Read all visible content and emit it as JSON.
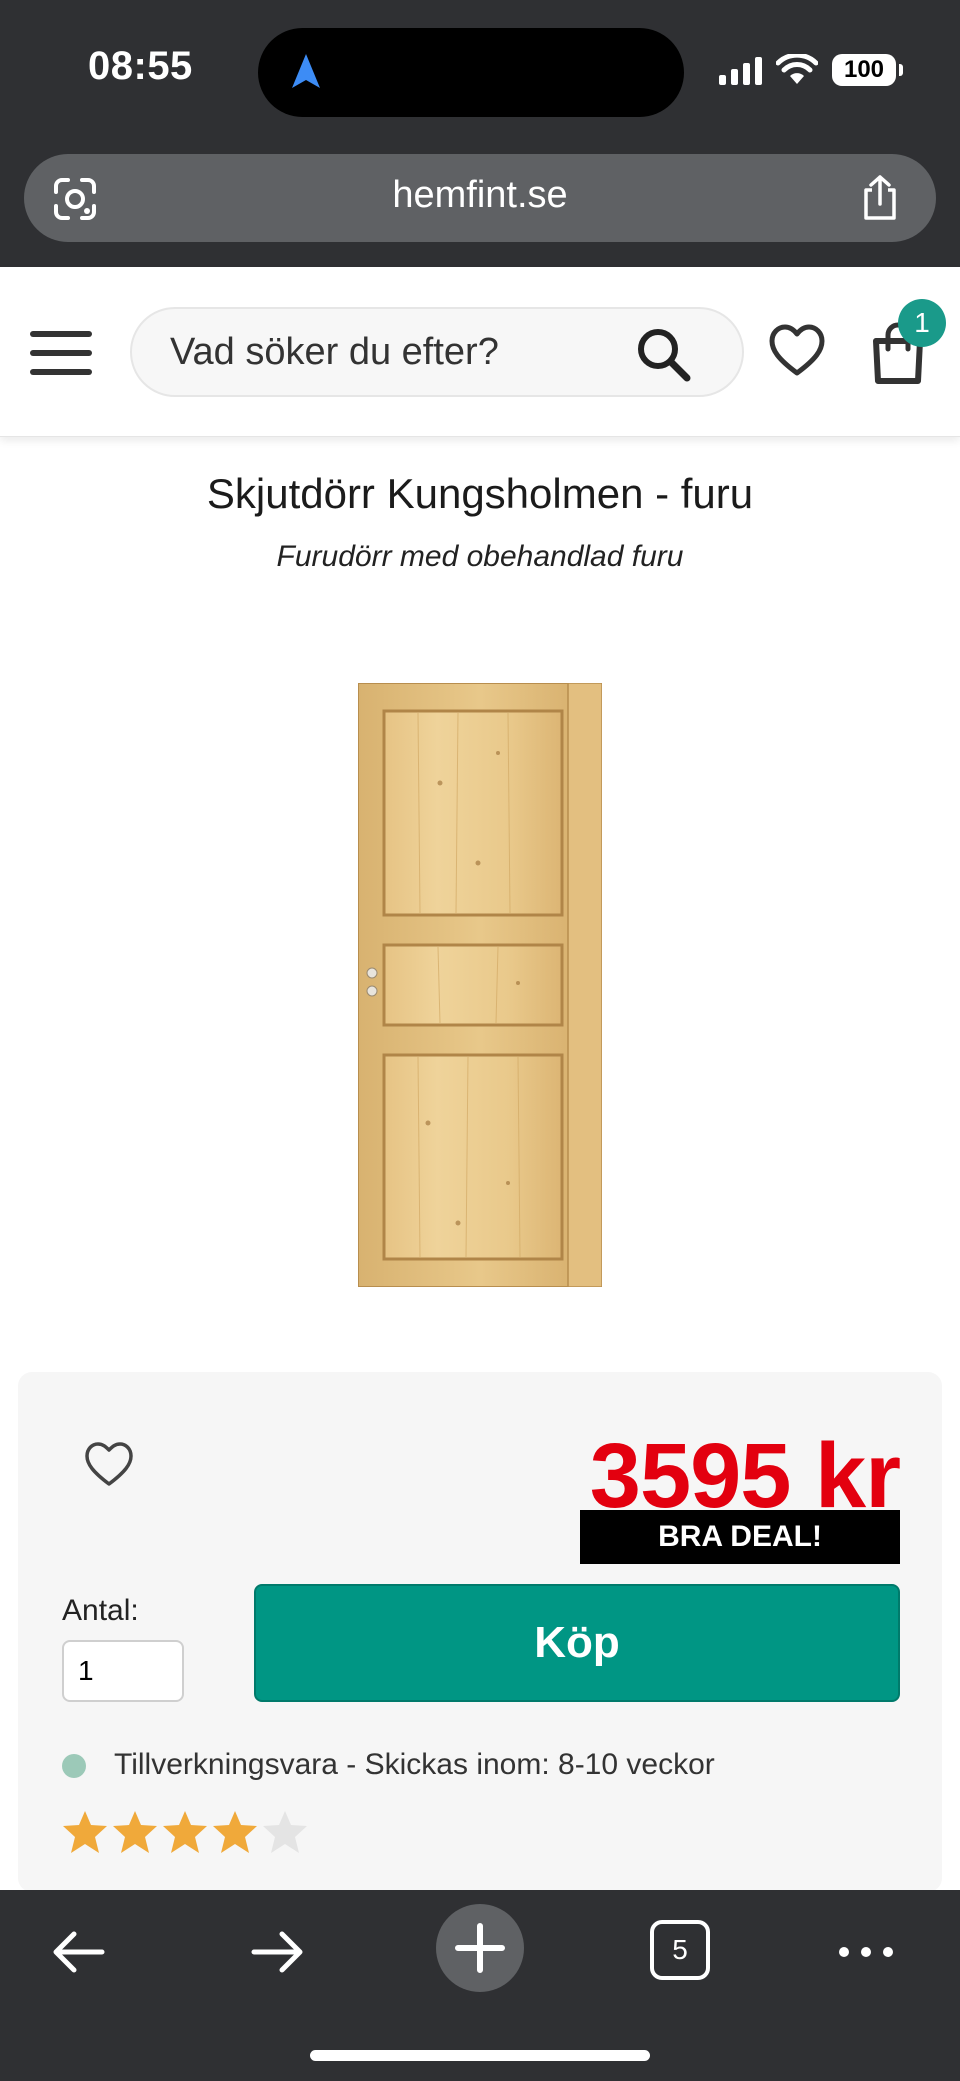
{
  "status_bar": {
    "time": "08:55",
    "battery": "100",
    "icons": [
      "location-arrow-icon",
      "signal-bars-icon",
      "wifi-icon",
      "battery-icon"
    ]
  },
  "browser": {
    "url": "hemfint.se",
    "tab_count": "5",
    "icons": [
      "google-lens-icon",
      "share-icon",
      "back-arrow-icon",
      "forward-arrow-icon",
      "new-tab-plus-icon",
      "tabs-icon",
      "more-dots-icon"
    ]
  },
  "header": {
    "search_placeholder": "Vad söker du efter?",
    "cart_count": "1",
    "icons": [
      "hamburger-menu-icon",
      "search-icon",
      "heart-icon",
      "shopping-bag-icon"
    ]
  },
  "product": {
    "title": "Skjutdörr Kungsholmen - furu",
    "subtitle": "Furudörr med obehandlad furu",
    "price": "3595 kr",
    "deal_label": "BRA DEAL!",
    "quantity_label": "Antal:",
    "quantity_value": "1",
    "buy_label": "Köp",
    "stock_text": "Tillverkningsvara - Skickas inom: 8-10 veckor",
    "rating": 4,
    "rating_max": 5
  },
  "colors": {
    "price_red": "#e3000f",
    "buy_teal": "#009684",
    "badge_teal": "#1a9a8a",
    "star_gold": "#f0a93a",
    "chrome_dark": "#2f3033"
  }
}
